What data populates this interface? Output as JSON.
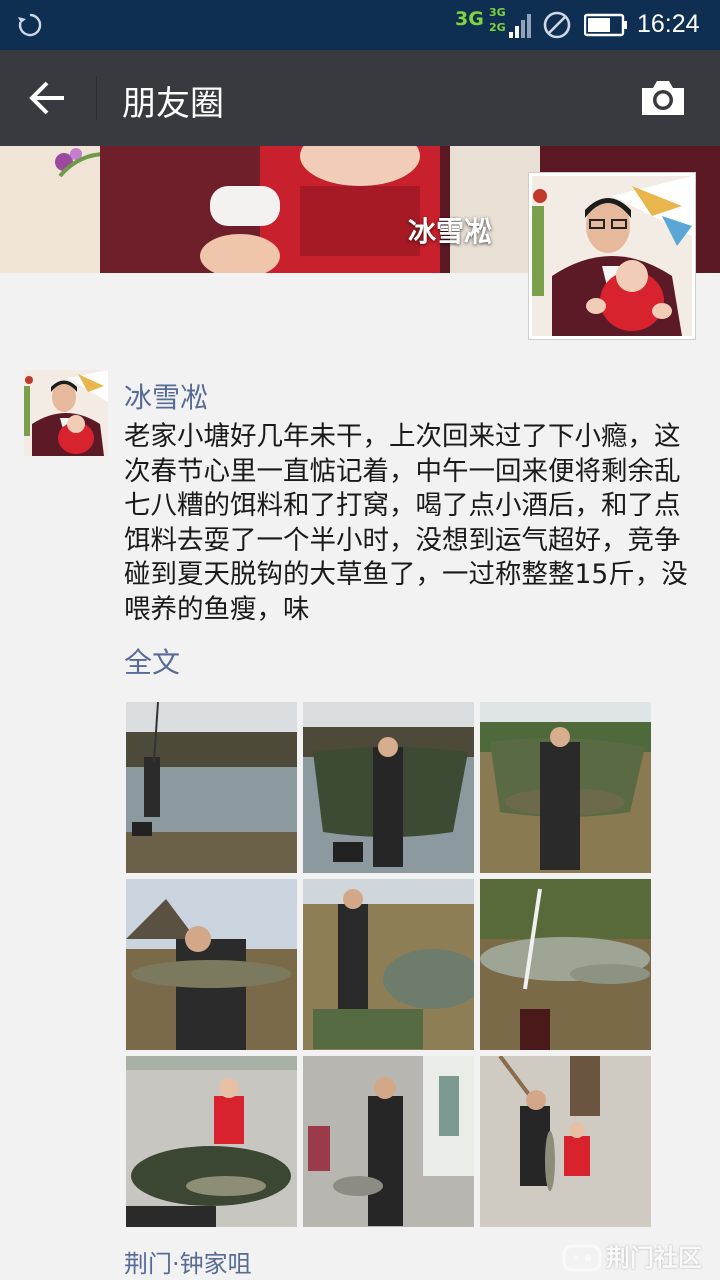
{
  "status_bar": {
    "network_primary": "3G",
    "network_secondary_top": "3G",
    "network_secondary_bottom": "2G",
    "time": "16:24",
    "icons": [
      "sync-icon",
      "signal-icon",
      "do-not-disturb-icon",
      "battery-icon"
    ]
  },
  "header": {
    "title": "朋友圈",
    "back_icon": "arrow-left-icon",
    "camera_icon": "camera-icon"
  },
  "profile": {
    "name": "冰雪凇"
  },
  "post": {
    "author": "冰雪凇",
    "text": "老家小塘好几年未干，上次回来过了下小瘾，这次春节心里一直惦记着，中午一回来便将剩余乱七八糟的饵料和了打窝，喝了点小酒后，和了点饵料去耍了一个半小时，没想到运气超好，竞争碰到夏天脱钩的大草鱼了，一过称整整15斤，没喂养的鱼瘦，味",
    "expand_label": "全文",
    "photo_count": 9,
    "location": "荆门·钟家咀"
  },
  "watermark": {
    "text": "荆门社区"
  },
  "colors": {
    "status_bar": "#0f2f52",
    "title_bar": "#393a3f",
    "link": "#576b95",
    "background": "#f2f2f2"
  }
}
